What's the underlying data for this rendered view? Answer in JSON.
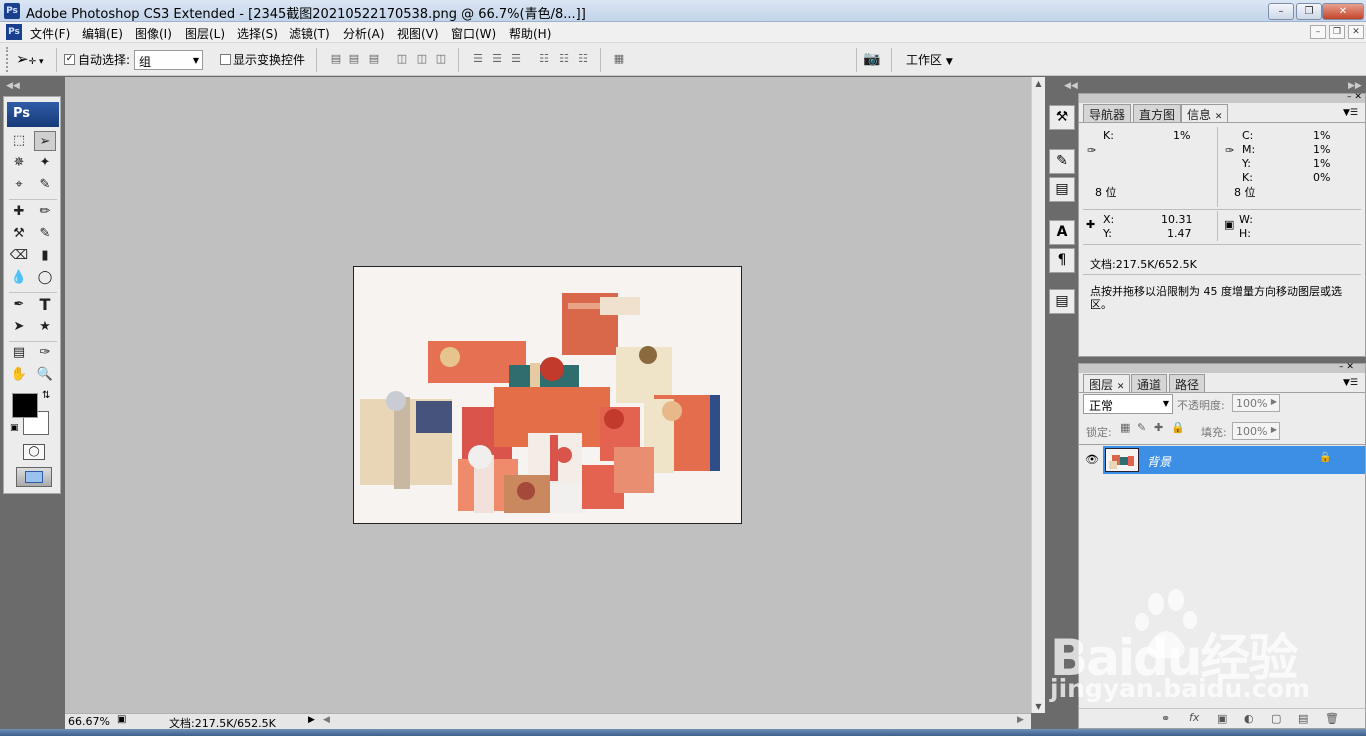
{
  "window": {
    "title": "Adobe Photoshop CS3 Extended - [2345截图20210522170538.png @ 66.7%(青色/8...]]",
    "logo": "Ps"
  },
  "menu": [
    "文件(F)",
    "编辑(E)",
    "图像(I)",
    "图层(L)",
    "选择(S)",
    "滤镜(T)",
    "分析(A)",
    "视图(V)",
    "窗口(W)",
    "帮助(H)"
  ],
  "options": {
    "auto_select_label": "自动选择:",
    "auto_select_value": "组",
    "show_transform_label": "显示变换控件",
    "workspace_label": "工作区"
  },
  "tools": {
    "logo": "Ps"
  },
  "status": {
    "zoom": "66.67%",
    "doc": "文档:217.5K/652.5K"
  },
  "info_panel": {
    "tabs": [
      "导航器",
      "直方图",
      "信息"
    ],
    "active_tab": "信息",
    "k_label": "K:",
    "k_value": "1%",
    "c_label": "C:",
    "c_value": "1%",
    "m_label": "M:",
    "m_value": "1%",
    "y_label": "Y:",
    "y_value": "1%",
    "k2_label": "K:",
    "k2_value": "0%",
    "bits_left": "8 位",
    "bits_right": "8 位",
    "x_label": "X:",
    "x_value": "10.31",
    "yy_label": "Y:",
    "yy_value": "1.47",
    "w_label": "W:",
    "h_label": "H:",
    "doc": "文档:217.5K/652.5K",
    "hint": "点按并拖移以沿限制为 45 度增量方向移动图层或选区。"
  },
  "layers_panel": {
    "tabs": [
      "图层",
      "通道",
      "路径"
    ],
    "active_tab": "图层",
    "blend_mode": "正常",
    "opacity_label": "不透明度:",
    "opacity_value": "100%",
    "lock_label": "锁定:",
    "fill_label": "填充:",
    "fill_value": "100%",
    "layer_name": "背景"
  },
  "watermark": {
    "brand": "Baidu经验",
    "url": "jingyan.baidu.com"
  }
}
